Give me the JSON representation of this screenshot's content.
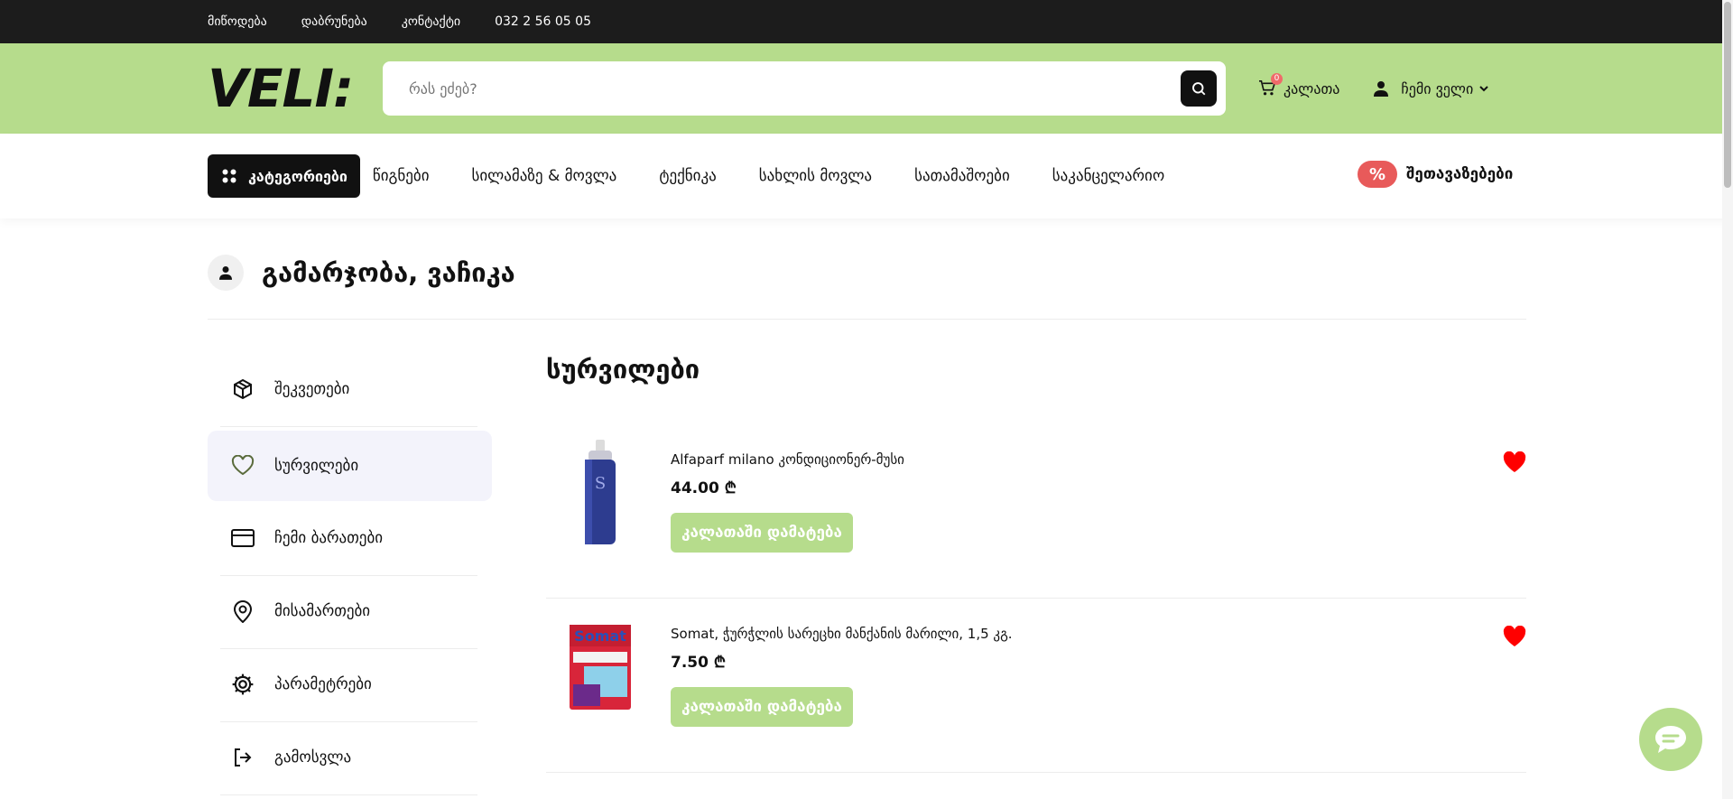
{
  "topbar": {
    "links": [
      "მიწოდება",
      "დაბრუნება",
      "კონტაქტი"
    ],
    "phone": "032 2 56 05 05"
  },
  "header": {
    "logo": "VELI:",
    "search_placeholder": "რას ეძებ?",
    "cart_label": "კალათა",
    "cart_count": "0",
    "account_label": "ჩემი ველი"
  },
  "nav": {
    "categories_label": "კატეგორიები",
    "items": [
      "წიგნები",
      "სილამაზე & მოვლა",
      "ტექნიკა",
      "სახლის მოვლა",
      "სათამაშოები",
      "საკანცელარიო"
    ],
    "offers_badge": "%",
    "offers_label": "შეთავაზებები"
  },
  "greeting": "გამარჯობა, ვაჩიკა",
  "sidebar": {
    "items": [
      {
        "label": "შეკვეთები",
        "icon": "box-icon"
      },
      {
        "label": "სურვილები",
        "icon": "heart-icon"
      },
      {
        "label": "ჩემი ბარათები",
        "icon": "card-icon"
      },
      {
        "label": "მისამართები",
        "icon": "location-pin-icon"
      },
      {
        "label": "პარამეტრები",
        "icon": "gear-icon"
      },
      {
        "label": "გამოსვლა",
        "icon": "logout-icon"
      }
    ],
    "active_index": 1
  },
  "main": {
    "title": "სურვილები",
    "products": [
      {
        "name": "Alfaparf milano კონდიციონერ-მუსი",
        "price": "44.00 ₾",
        "button": "კალათაში დამატება"
      },
      {
        "name": "Somat, ჭურჭლის სარეცხი მანქანის მარილი, 1,5 კგ.",
        "price": "7.50 ₾",
        "button": "კალათაში დამატება",
        "brand_text": "Somat"
      }
    ]
  },
  "colors": {
    "brand_green": "#b6dc8c",
    "dark": "#1c1c1c",
    "heart_red": "#ff0000",
    "offers_red": "#e85a5a"
  }
}
